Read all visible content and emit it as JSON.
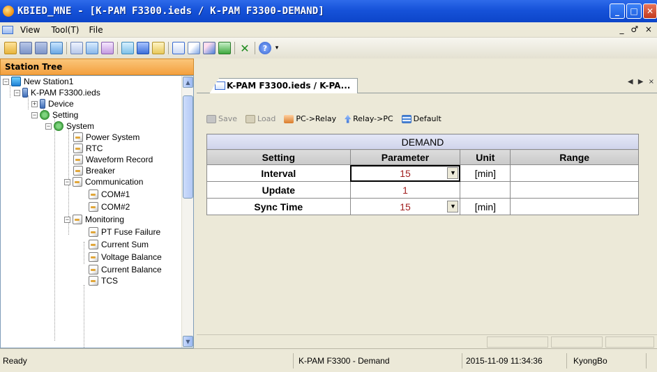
{
  "window": {
    "title": "KBIED_MNE - [K-PAM F3300.ieds / K-PAM F3300-DEMAND]"
  },
  "menu": {
    "items": [
      "View",
      "Tool(T)",
      "File"
    ],
    "mdi_controls": "_ ♂ ×"
  },
  "toolbar": {
    "icons": [
      "open-folder-icon",
      "save-icon",
      "save-all-icon",
      "network-icon",
      "document-icon",
      "edit-icon",
      "wizard-icon",
      "connect-icon",
      "monitor-icon",
      "calendar-icon",
      "window-icon",
      "graph-icon",
      "compare-icon",
      "download-icon",
      "delete-icon",
      "help-icon"
    ],
    "colors": {
      "accent": "#2e6bea"
    }
  },
  "station_tree": {
    "header": "Station Tree",
    "nodes": [
      {
        "label": "New Station1",
        "icon": "station-icon"
      },
      {
        "label": "K-PAM F3300.ieds",
        "icon": "ied-icon"
      },
      {
        "label": "Device",
        "icon": "ied-icon"
      },
      {
        "label": "Setting",
        "icon": "gear-icon"
      },
      {
        "label": "System",
        "icon": "gear-icon"
      },
      {
        "label": "Power System",
        "icon": "document-icon"
      },
      {
        "label": "RTC",
        "icon": "document-icon"
      },
      {
        "label": "Waveform Record",
        "icon": "document-icon"
      },
      {
        "label": "Breaker",
        "icon": "document-icon"
      },
      {
        "label": "Communication",
        "icon": "document-icon"
      },
      {
        "label": "COM#1",
        "icon": "document-icon"
      },
      {
        "label": "COM#2",
        "icon": "document-icon"
      },
      {
        "label": "Monitoring",
        "icon": "document-icon"
      },
      {
        "label": "PT Fuse Failure",
        "icon": "document-icon"
      },
      {
        "label": "Current Sum",
        "icon": "document-icon"
      },
      {
        "label": "Voltage Balance",
        "icon": "document-icon"
      },
      {
        "label": "Current Balance",
        "icon": "document-icon"
      },
      {
        "label": "TCS",
        "icon": "document-icon"
      }
    ]
  },
  "tab": {
    "label": "K-PAM F3300.ieds / K-PA...",
    "nav": "◀ ▶ ×"
  },
  "actions": {
    "save": "Save",
    "load": "Load",
    "pc_to_relay": "PC->Relay",
    "relay_to_pc": "Relay->PC",
    "default": "Default"
  },
  "table": {
    "group_title": "DEMAND",
    "columns": {
      "setting": "Setting",
      "parameter": "Parameter",
      "unit": "Unit",
      "range": "Range"
    },
    "rows": [
      {
        "setting": "Interval",
        "parameter": "15",
        "unit": "[min]",
        "range": "",
        "dropdown": true
      },
      {
        "setting": "Update",
        "parameter": "1",
        "unit": "",
        "range": "",
        "dropdown": false
      },
      {
        "setting": "Sync Time",
        "parameter": "15",
        "unit": "[min]",
        "range": "",
        "dropdown": true
      }
    ]
  },
  "status": {
    "left": "Ready",
    "device": "K-PAM F3300 - Demand",
    "datetime": "2015-11-09 11:34:36",
    "user": "KyongBo"
  }
}
